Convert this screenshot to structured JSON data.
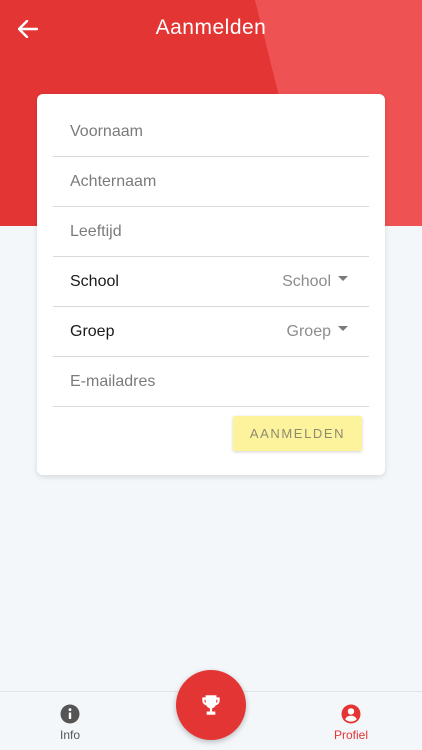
{
  "header": {
    "title": "Aanmelden",
    "back_icon": "arrow-left-icon"
  },
  "form": {
    "first_name_placeholder": "Voornaam",
    "last_name_placeholder": "Achternaam",
    "age_placeholder": "Leeftijd",
    "school_label": "School",
    "school_value": "School",
    "group_label": "Groep",
    "group_value": "Groep",
    "email_placeholder": "E-mailadres",
    "submit_label": "AANMELDEN"
  },
  "bottom_nav": {
    "info_label": "Info",
    "profile_label": "Profiel",
    "info_icon": "info-icon",
    "profile_icon": "account-circle-icon",
    "fab_icon": "trophy-icon"
  },
  "colors": {
    "primary": "#e43535",
    "primary_light": "#ef5253",
    "button_bg": "#fdf39c",
    "background": "#f4f7fa"
  }
}
